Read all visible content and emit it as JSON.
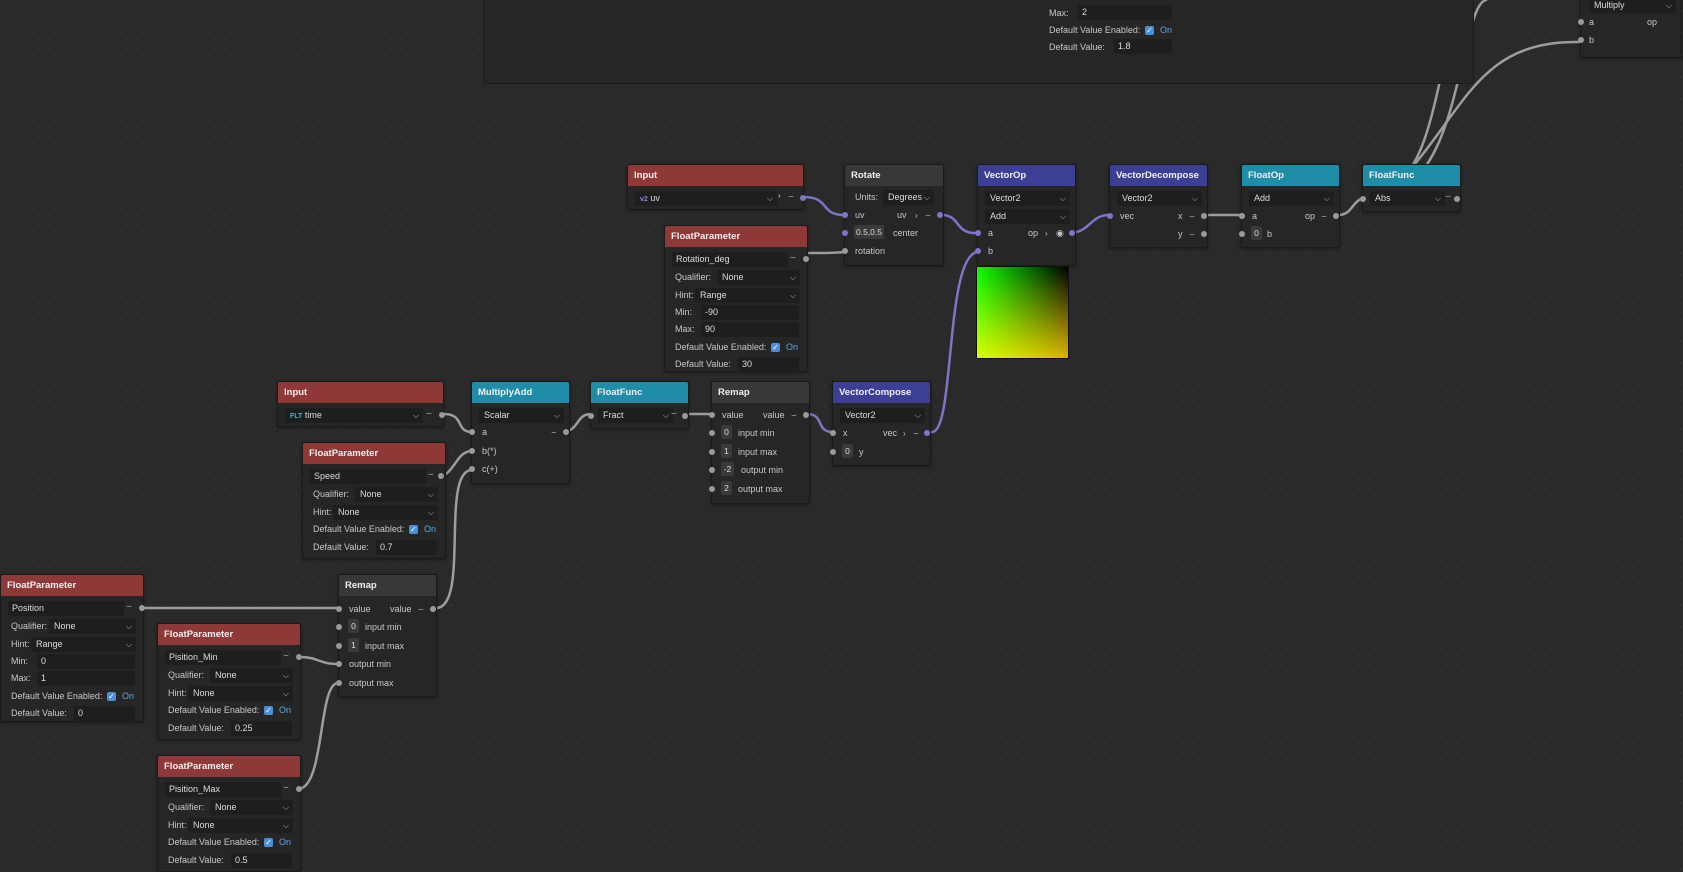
{
  "frame_top": {
    "max_label": "Max:",
    "max_value": "2",
    "default_enabled_label": "Default Value Enabled:",
    "on_label": "On",
    "default_value_label": "Default Value:",
    "default_value": "1.8"
  },
  "multiply_top": {
    "op": "Multiply",
    "socket_a": "a",
    "socket_op": "op",
    "socket_b": "b"
  },
  "input_uv": {
    "title": "Input",
    "tag": "v2",
    "value": "uv"
  },
  "rotate": {
    "title": "Rotate",
    "units_label": "Units:",
    "units": "Degrees",
    "in_uv": "uv",
    "out_uv": "uv",
    "center_value": "0.5,0.5",
    "center": "center",
    "rotation": "rotation"
  },
  "vectorop": {
    "title": "VectorOp",
    "type": "Vector2",
    "op": "Add",
    "a": "a",
    "op_out": "op",
    "b": "b"
  },
  "vecdecomp": {
    "title": "VectorDecompose",
    "type": "Vector2",
    "vec": "vec",
    "x": "x",
    "y": "y"
  },
  "floatop": {
    "title": "FloatOp",
    "op": "Add",
    "a": "a",
    "op_out": "op",
    "b_value": "0",
    "b": "b"
  },
  "floatfunc_abs": {
    "title": "FloatFunc",
    "func": "Abs"
  },
  "fp_rotation": {
    "title": "FloatParameter",
    "name": "Rotation_deg",
    "qualifier_label": "Qualifier:",
    "qualifier": "None",
    "hint_label": "Hint:",
    "hint": "Range",
    "min_label": "Min:",
    "min": "-90",
    "max_label": "Max:",
    "max": "90",
    "default_enabled_label": "Default Value Enabled:",
    "on_label": "On",
    "default_value_label": "Default Value:",
    "default_value": "30"
  },
  "input_time": {
    "title": "Input",
    "tag": "FLT",
    "value": "time"
  },
  "fp_speed": {
    "title": "FloatParameter",
    "name": "Speed",
    "qualifier_label": "Qualifier:",
    "qualifier": "None",
    "hint_label": "Hint:",
    "hint": "None",
    "default_enabled_label": "Default Value Enabled:",
    "on_label": "On",
    "default_value_label": "Default Value:",
    "default_value": "0.7"
  },
  "multiplyadd": {
    "title": "MultiplyAdd",
    "type": "Scalar",
    "a": "a",
    "b": "b(*)",
    "c": "c(+)"
  },
  "floatfunc_fract": {
    "title": "FloatFunc",
    "func": "Fract"
  },
  "remap_top": {
    "title": "Remap",
    "value_in": "value",
    "value_out": "value",
    "in_min_v": "0",
    "in_min": "input min",
    "in_max_v": "1",
    "in_max": "input max",
    "out_min_v": "-2",
    "out_min": "output min",
    "out_max_v": "2",
    "out_max": "output max"
  },
  "vectorcompose": {
    "title": "VectorCompose",
    "type": "Vector2",
    "x": "x",
    "vec": "vec",
    "y_value": "0",
    "y": "y"
  },
  "fp_position": {
    "title": "FloatParameter",
    "name": "Position",
    "qualifier_label": "Qualifier:",
    "qualifier": "None",
    "hint_label": "Hint:",
    "hint": "Range",
    "min_label": "Min:",
    "min": "0",
    "max_label": "Max:",
    "max": "1",
    "default_enabled_label": "Default Value Enabled:",
    "on_label": "On",
    "default_value_label": "Default Value:",
    "default_value": "0"
  },
  "remap_bottom": {
    "title": "Remap",
    "value_in": "value",
    "value_out": "value",
    "in_min_v": "0",
    "in_min": "input min",
    "in_max_v": "1",
    "in_max": "input max",
    "out_min": "output min",
    "out_max": "output max"
  },
  "fp_pmin": {
    "title": "FloatParameter",
    "name": "Pisition_Min",
    "qualifier_label": "Qualifier:",
    "qualifier": "None",
    "hint_label": "Hint:",
    "hint": "None",
    "default_enabled_label": "Default Value Enabled:",
    "on_label": "On",
    "default_value_label": "Default Value:",
    "default_value": "0.25"
  },
  "fp_pmax": {
    "title": "FloatParameter",
    "name": "Pisition_Max",
    "qualifier_label": "Qualifier:",
    "qualifier": "None",
    "hint_label": "Hint:",
    "hint": "None",
    "default_enabled_label": "Default Value Enabled:",
    "on_label": "On",
    "default_value_label": "Default Value:",
    "default_value": "0.5"
  },
  "colors": {
    "parameter_header": "#8e3838",
    "function_header": "#1f8ca8",
    "vector_header": "#3c3f94",
    "neutral_header": "#383838",
    "vector_wire": "#7b76c8",
    "float_wire": "#9a9a9a",
    "toggle": "#4a90d9"
  }
}
